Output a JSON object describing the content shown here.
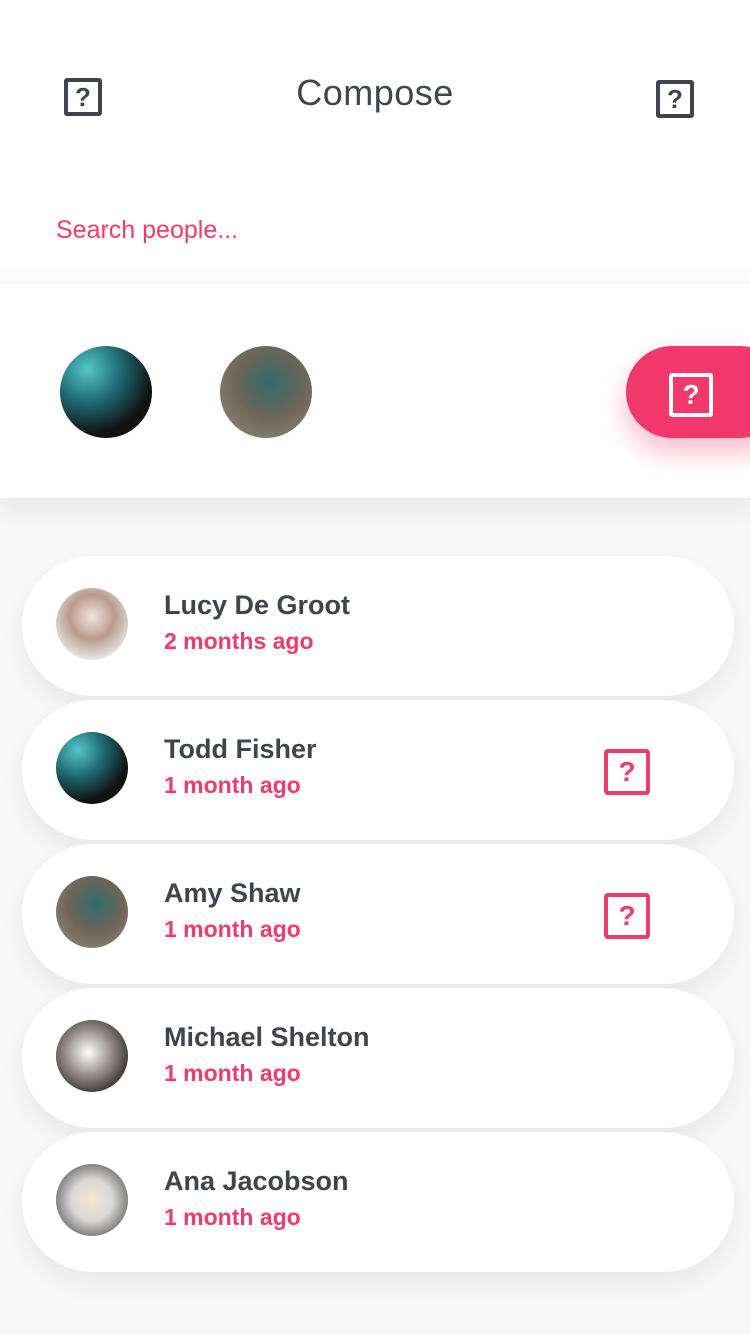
{
  "header": {
    "title": "Compose",
    "left_icon": "unknown-icon",
    "right_icon": "unknown-icon",
    "icon_glyph": "?"
  },
  "search": {
    "placeholder": "Search people..."
  },
  "selected": {
    "fab_icon": "unknown-icon",
    "fab_glyph": "?"
  },
  "contacts": [
    {
      "name": "Lucy De Groot",
      "time": "2 months ago",
      "selected": false
    },
    {
      "name": "Todd Fisher",
      "time": "1 month ago",
      "selected": true
    },
    {
      "name": "Amy Shaw",
      "time": "1 month ago",
      "selected": true
    },
    {
      "name": "Michael Shelton",
      "time": "1 month ago",
      "selected": false
    },
    {
      "name": "Ana Jacobson",
      "time": "1 month ago",
      "selected": false
    }
  ],
  "row_icon_glyph": "?",
  "colors": {
    "accent": "#ee3c6b",
    "text": "#3f4452",
    "fab": "#f2386a"
  }
}
